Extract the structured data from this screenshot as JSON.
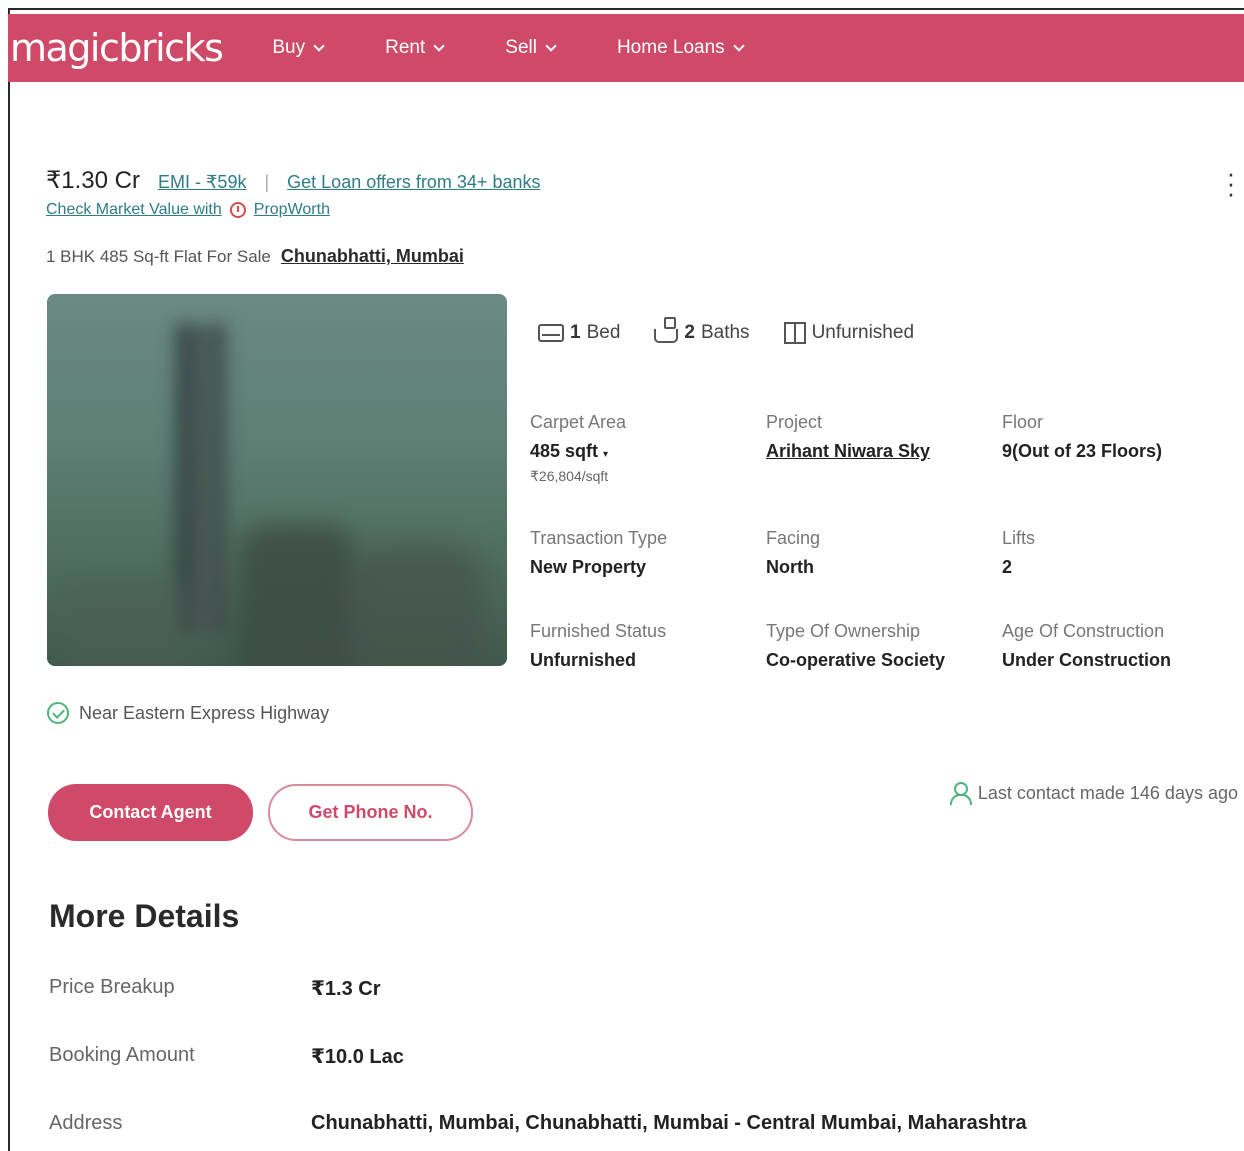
{
  "header": {
    "logo": "magicbricks",
    "nav": [
      {
        "label": "Buy"
      },
      {
        "label": "Rent"
      },
      {
        "label": "Sell"
      },
      {
        "label": "Home Loans"
      }
    ]
  },
  "listing": {
    "price": "₹1.30 Cr",
    "emi": "EMI - ₹59k",
    "loan_offers": "Get Loan offers from 34+ banks",
    "market_value": "Check Market Value with",
    "propworth": "PropWorth",
    "title": "1 BHK 485 Sq-ft Flat For Sale",
    "location": "Chunabhatti, Mumbai",
    "features": {
      "bed_count": "1",
      "bed_label": "Bed",
      "bath_count": "2",
      "bath_label": "Baths",
      "furnishing": "Unfurnished"
    },
    "details": {
      "carpet_area_label": "Carpet Area",
      "carpet_area_value": "485 sqft",
      "carpet_area_rate": "₹26,804/sqft",
      "project_label": "Project",
      "project_value": "Arihant Niwara Sky",
      "floor_label": "Floor",
      "floor_value": "9(Out of 23 Floors)",
      "transaction_label": "Transaction Type",
      "transaction_value": "New Property",
      "facing_label": "Facing",
      "facing_value": "North",
      "lifts_label": "Lifts",
      "lifts_value": "2",
      "furnished_label": "Furnished Status",
      "furnished_value": "Unfurnished",
      "ownership_label": "Type Of Ownership",
      "ownership_value": "Co-operative Society",
      "age_label": "Age Of Construction",
      "age_value": "Under Construction"
    },
    "highlight": "Near Eastern Express Highway",
    "contact_agent": "Contact Agent",
    "get_phone": "Get Phone No.",
    "last_contact": "Last contact made 146 days ago"
  },
  "more_details": {
    "title": "More Details",
    "rows": [
      {
        "label": "Price Breakup",
        "value": "₹1.3 Cr"
      },
      {
        "label": "Booking Amount",
        "value": "₹10.0 Lac"
      },
      {
        "label": "Address",
        "value": "Chunabhatti, Mumbai, Chunabhatti, Mumbai - Central Mumbai, Maharashtra"
      }
    ]
  },
  "colors": {
    "brand": "#cf4a69",
    "link": "#2f7c85",
    "success": "#4fb37c"
  }
}
